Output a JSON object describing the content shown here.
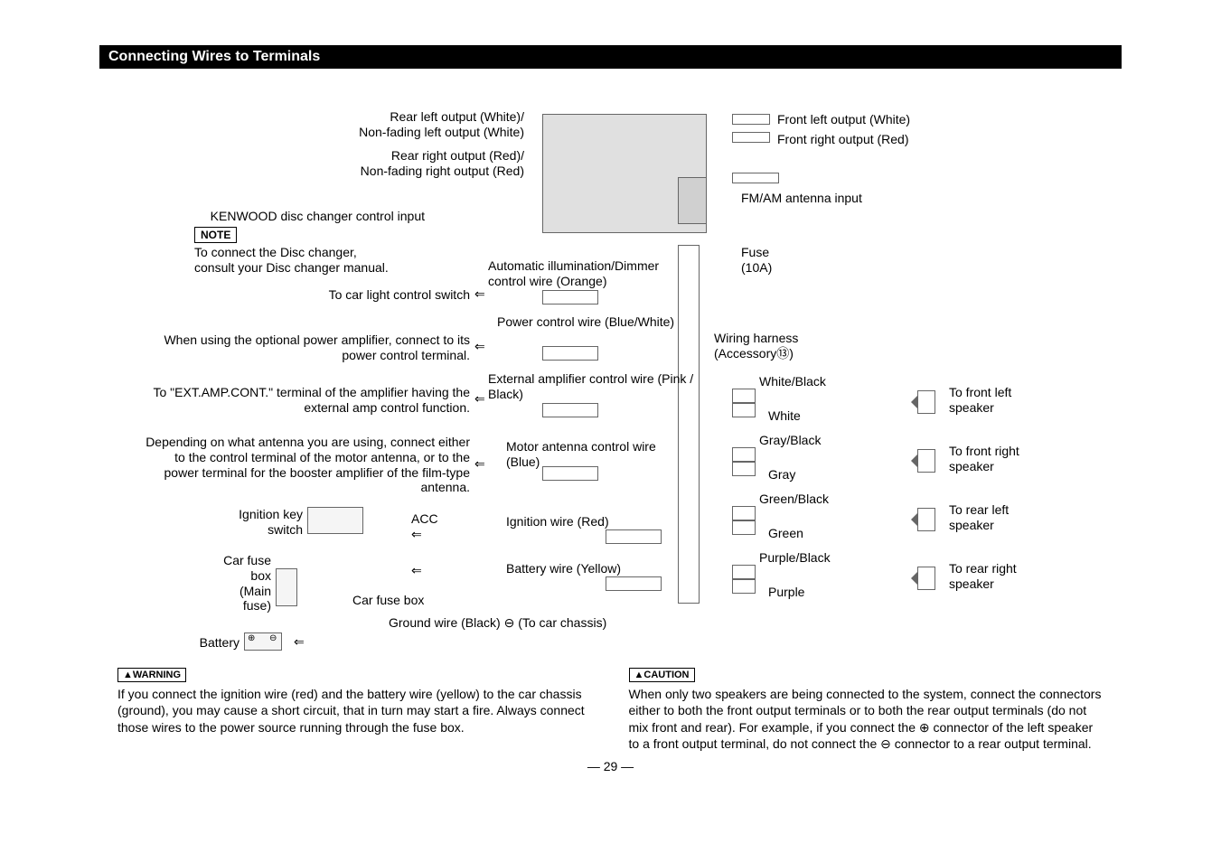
{
  "section_title": "Connecting Wires to Terminals",
  "labels": {
    "rear_left": "Rear left output (White)/\nNon-fading left output (White)",
    "rear_right": "Rear right output (Red)/\nNon-fading right output (Red)",
    "front_left": "Front left output (White)",
    "front_right": "Front right output (Red)",
    "fm_am": "FM/AM antenna input",
    "disc_changer": "KENWOOD disc changer control input",
    "note": "NOTE",
    "note_text": "To connect the Disc changer,\nconsult your Disc changer manual.",
    "fuse": "Fuse\n(10A)",
    "auto_illum": "Automatic illumination/Dimmer control wire (Orange)",
    "car_light": "To car light control switch",
    "power_ctrl": "Power control wire (Blue/White)",
    "power_amp": "When using the optional power amplifier, connect to its power control terminal.",
    "harness": "Wiring harness (Accessory⑬)",
    "ext_amp_wire": "External amplifier control wire (Pink / Black)",
    "ext_amp_dest": "To \"EXT.AMP.CONT.\" terminal of the amplifier having the external amp control function.",
    "motor_ant": "Motor antenna control wire (Blue)",
    "motor_ant_dest": "Depending on what antenna you are using, connect either to the control terminal of the motor antenna, or to the power terminal for the booster amplifier of the film-type antenna.",
    "ignition_wire": "Ignition wire (Red)",
    "ignition_key": "Ignition key\nswitch",
    "acc": "ACC",
    "battery_wire": "Battery wire (Yellow)",
    "car_fuse_main": "Car fuse\nbox\n(Main\nfuse)",
    "car_fuse": "Car fuse box",
    "ground": "Ground wire (Black) ⊖ (To car chassis)",
    "battery": "Battery",
    "spk_fl_top": "White/Black",
    "spk_fl_bot": "White",
    "spk_fr_top": "Gray/Black",
    "spk_fr_bot": "Gray",
    "spk_rl_top": "Green/Black",
    "spk_rl_bot": "Green",
    "spk_rr_top": "Purple/Black",
    "spk_rr_bot": "Purple",
    "to_fl": "To front left speaker",
    "to_fr": "To front right speaker",
    "to_rl": "To rear left speaker",
    "to_rr": "To rear right speaker"
  },
  "warning": {
    "label": "▲WARNING",
    "text": "If you connect the ignition wire (red) and the battery wire (yellow) to the car chassis (ground), you may cause a short circuit, that in turn may start a fire. Always connect those wires to the power source running through the fuse box."
  },
  "caution": {
    "label": "▲CAUTION",
    "text": "When only two speakers are being connected to the system, connect the connectors either to both the front output terminals or to both the rear output terminals (do not mix front and rear). For example, if you connect the ⊕ connector of the left speaker to a front output terminal, do not connect the ⊖ connector to a rear output terminal."
  },
  "page": "— 29 —"
}
